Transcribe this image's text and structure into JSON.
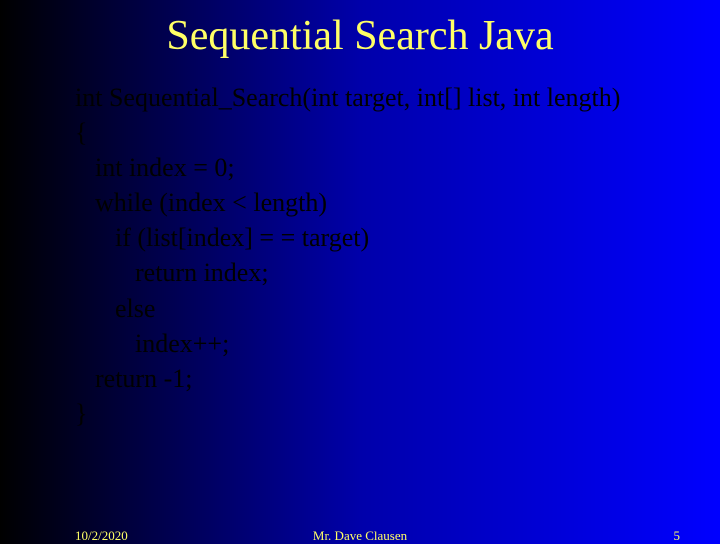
{
  "title": "Sequential Search Java",
  "code": {
    "line1": "int Sequential_Search(int target, int[] list, int length)",
    "line2": "{",
    "line3": "int index = 0;",
    "line4": "while (index < length)",
    "line5": "if (list[index] = = target)",
    "line6": "return index;",
    "line7": "else",
    "line8": "index++;",
    "line9": "return -1;",
    "line10": "}"
  },
  "footer": {
    "date": "10/2/2020",
    "author": "Mr. Dave Clausen",
    "page": "5"
  }
}
